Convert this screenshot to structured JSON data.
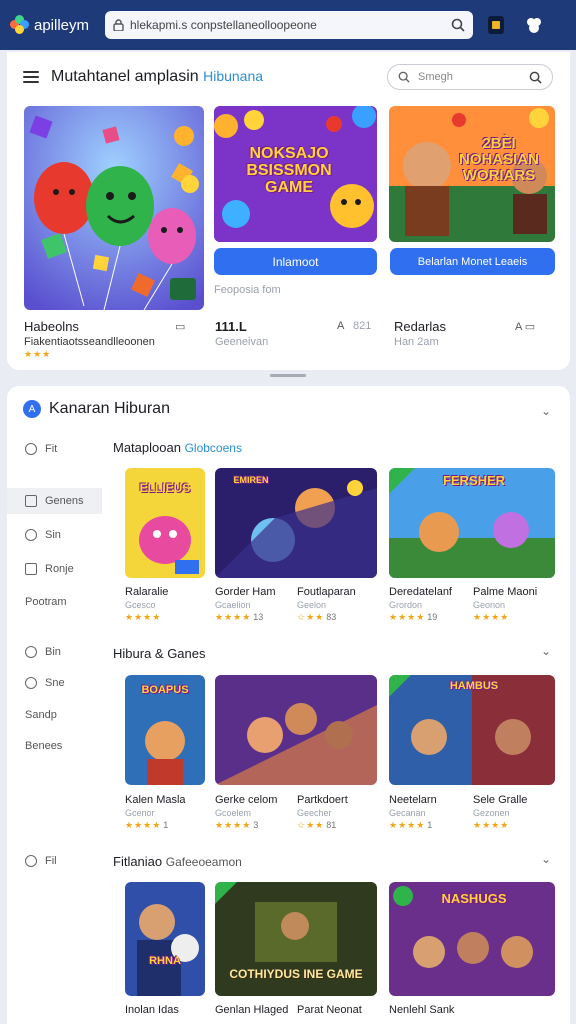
{
  "browser": {
    "brand": "apilleym",
    "url": "hlekapmi.s conpstellaneolloopeone"
  },
  "header": {
    "title": "Mutahtanel amplasin",
    "title_accent": "Hibunana",
    "search_placeholder": "Smegh"
  },
  "featured": [
    {
      "name": "Habeolns",
      "sub": "Fiakentiaotsseandlleoonen",
      "art": "Balloons"
    },
    {
      "name": "111.L",
      "sub": "Geeneivan",
      "art": "NOKSAJO BSISSMON GAME",
      "cta": "Inlamoot",
      "caption": "Feoposia fom",
      "rating": "821"
    },
    {
      "name": "Redarlas",
      "sub": "Han 2am",
      "art": "2BÈI NOHASIAN WORIARS",
      "cta": "Belarlan Monet Leaeis"
    }
  ],
  "section_header": "Kanaran Hiburan",
  "sidebar": {
    "items": [
      {
        "label": "Fit"
      },
      {
        "label": "Genens"
      },
      {
        "label": "Sin"
      },
      {
        "label": "Ronje"
      },
      {
        "label": "Pootram"
      },
      {
        "label": "Bin"
      },
      {
        "label": "Sne"
      },
      {
        "label": "Sandp"
      },
      {
        "label": "Benees"
      },
      {
        "label": "Fil"
      }
    ]
  },
  "sections": [
    {
      "title": "Mataplooan",
      "accent": "Globcoens",
      "games": [
        {
          "name": "Ralaralie",
          "sub": "Gcesco",
          "rating": "",
          "art": "ELLIEUS"
        },
        {
          "name": "Gorder Ham",
          "sub": "Gcaelion",
          "rating": "13",
          "art": "EMIREN",
          "name2": "Foutlaparan",
          "sub2": "Geelon",
          "rating2": "83"
        },
        {
          "name": "Deredatelanf",
          "sub": "Grordon",
          "rating": "19",
          "art": "FERSHER",
          "name2": "Palme Maoni",
          "sub2": "Geonon",
          "rating2": ""
        }
      ]
    },
    {
      "title": "Hibura & Ganes",
      "accent": "",
      "games": [
        {
          "name": "Kalen Masla",
          "sub": "Gcenor",
          "rating": "1",
          "art": "BOAPUS"
        },
        {
          "name": "Gerke celom",
          "sub": "Gcoelem",
          "rating": "3",
          "art": "",
          "name2": "Partkdoert",
          "sub2": "Geecher",
          "rating2": "81"
        },
        {
          "name": "Neetelarn",
          "sub": "Gecanan",
          "rating": "1",
          "art": "HAMBUS",
          "name2": "Sele Gralle",
          "sub2": "Gezonen",
          "rating2": ""
        }
      ]
    },
    {
      "title": "Fitlaniao",
      "accent": "Gafeeoeamon",
      "games": [
        {
          "name": "Inolan Idas",
          "sub": "",
          "art": "RHNA"
        },
        {
          "name": "Genlan Hlaged",
          "sub": "",
          "art": "COTHIYDUS INE GAME",
          "name2": "Parat Neonat"
        },
        {
          "name": "Nenlehl Sank",
          "sub": "",
          "art": "NASHUGS"
        }
      ]
    }
  ],
  "colors": {
    "topbar": "#1e3a78",
    "accent_blue": "#2f6ff0",
    "star": "#f2a516"
  }
}
